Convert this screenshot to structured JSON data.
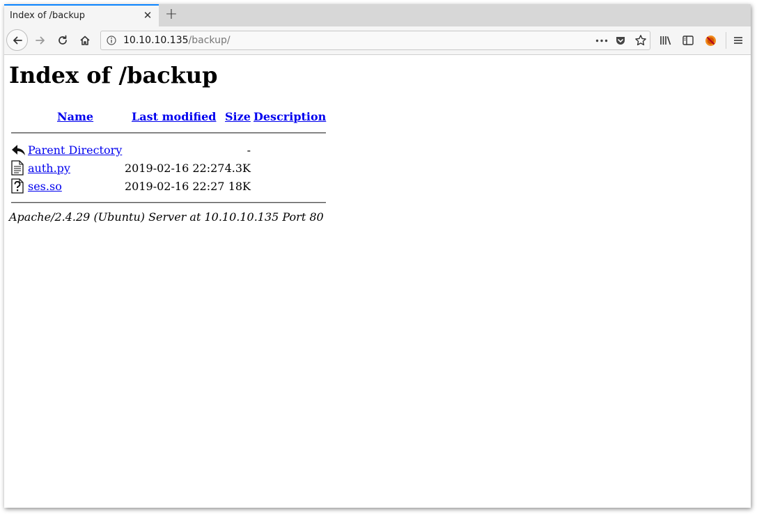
{
  "browser": {
    "tab_title": "Index of /backup",
    "tab_close": "✕",
    "new_tab": "+",
    "url_host": "10.10.10.135",
    "url_path": "/backup/",
    "accent_color": "#0a84ff"
  },
  "page": {
    "title": "Index of /backup",
    "columns": {
      "name": "Name",
      "last_modified": "Last modified",
      "size": "Size",
      "description": "Description"
    },
    "rows": [
      {
        "icon": "back-arrow-icon",
        "name": "Parent Directory",
        "modified": "",
        "size": "-"
      },
      {
        "icon": "text-file-icon",
        "name": "auth.py",
        "modified": "2019-02-16 22:27",
        "size": "4.3K"
      },
      {
        "icon": "unknown-file-icon",
        "name": "ses.so",
        "modified": "2019-02-16 22:27",
        "size": "18K"
      }
    ],
    "footer": "Apache/2.4.29 (Ubuntu) Server at 10.10.10.135 Port 80",
    "link_color": "#0000ee"
  }
}
